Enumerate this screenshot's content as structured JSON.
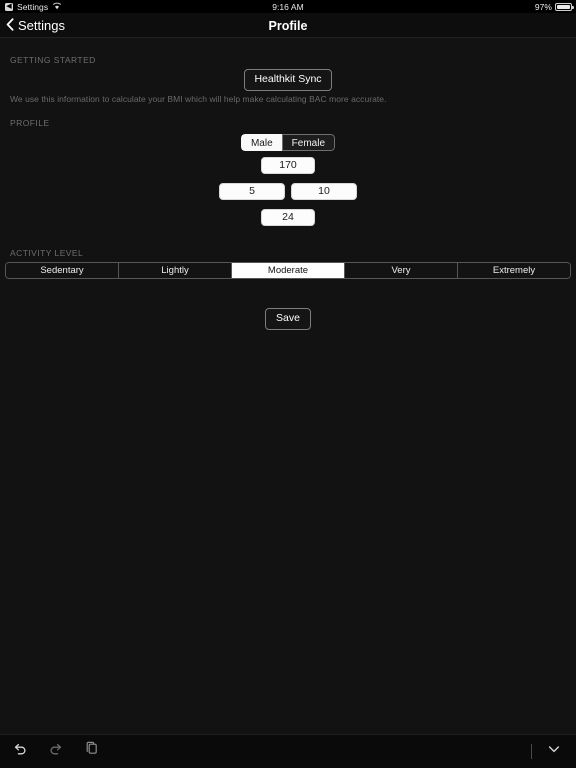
{
  "status_bar": {
    "back_app_glyph": "◀",
    "back_app_label": "Settings",
    "wifi_icon": "wifi-icon",
    "time": "9:16 AM",
    "battery_percent": "97%",
    "battery_icon": "battery-icon"
  },
  "nav_bar": {
    "back_icon": "chevron-left-icon",
    "back_label": "Settings",
    "title": "Profile"
  },
  "sections": {
    "getting_started": {
      "label": "GETTING STARTED",
      "healthkit_button": "Healthkit Sync",
      "helper_text": "We use this information to calculate your BMI which will help make calculating BAC more accurate."
    },
    "profile": {
      "label": "PROFILE",
      "gender": {
        "options": [
          "Male",
          "Female"
        ],
        "selected": "Male"
      },
      "height_value": "170",
      "weight_value": "5",
      "weight_secondary_value": "10",
      "age_value": "24"
    },
    "activity": {
      "label": "ACTIVITY LEVEL",
      "options": [
        "Sedentary",
        "Lightly",
        "Moderate",
        "Very",
        "Extremely"
      ],
      "selected": "Moderate"
    },
    "save_button": "Save"
  },
  "toolbar": {
    "undo_icon": "undo-icon",
    "redo_icon": "redo-icon",
    "copy_icon": "copy-icon",
    "dismiss_icon": "chevron-down-icon"
  },
  "colors": {
    "background": "#121212",
    "nav_background": "#0d0d0d",
    "field_background": "#fcfcfc",
    "section_label": "#6e6e6e",
    "accent_selected": "#ffffff"
  }
}
